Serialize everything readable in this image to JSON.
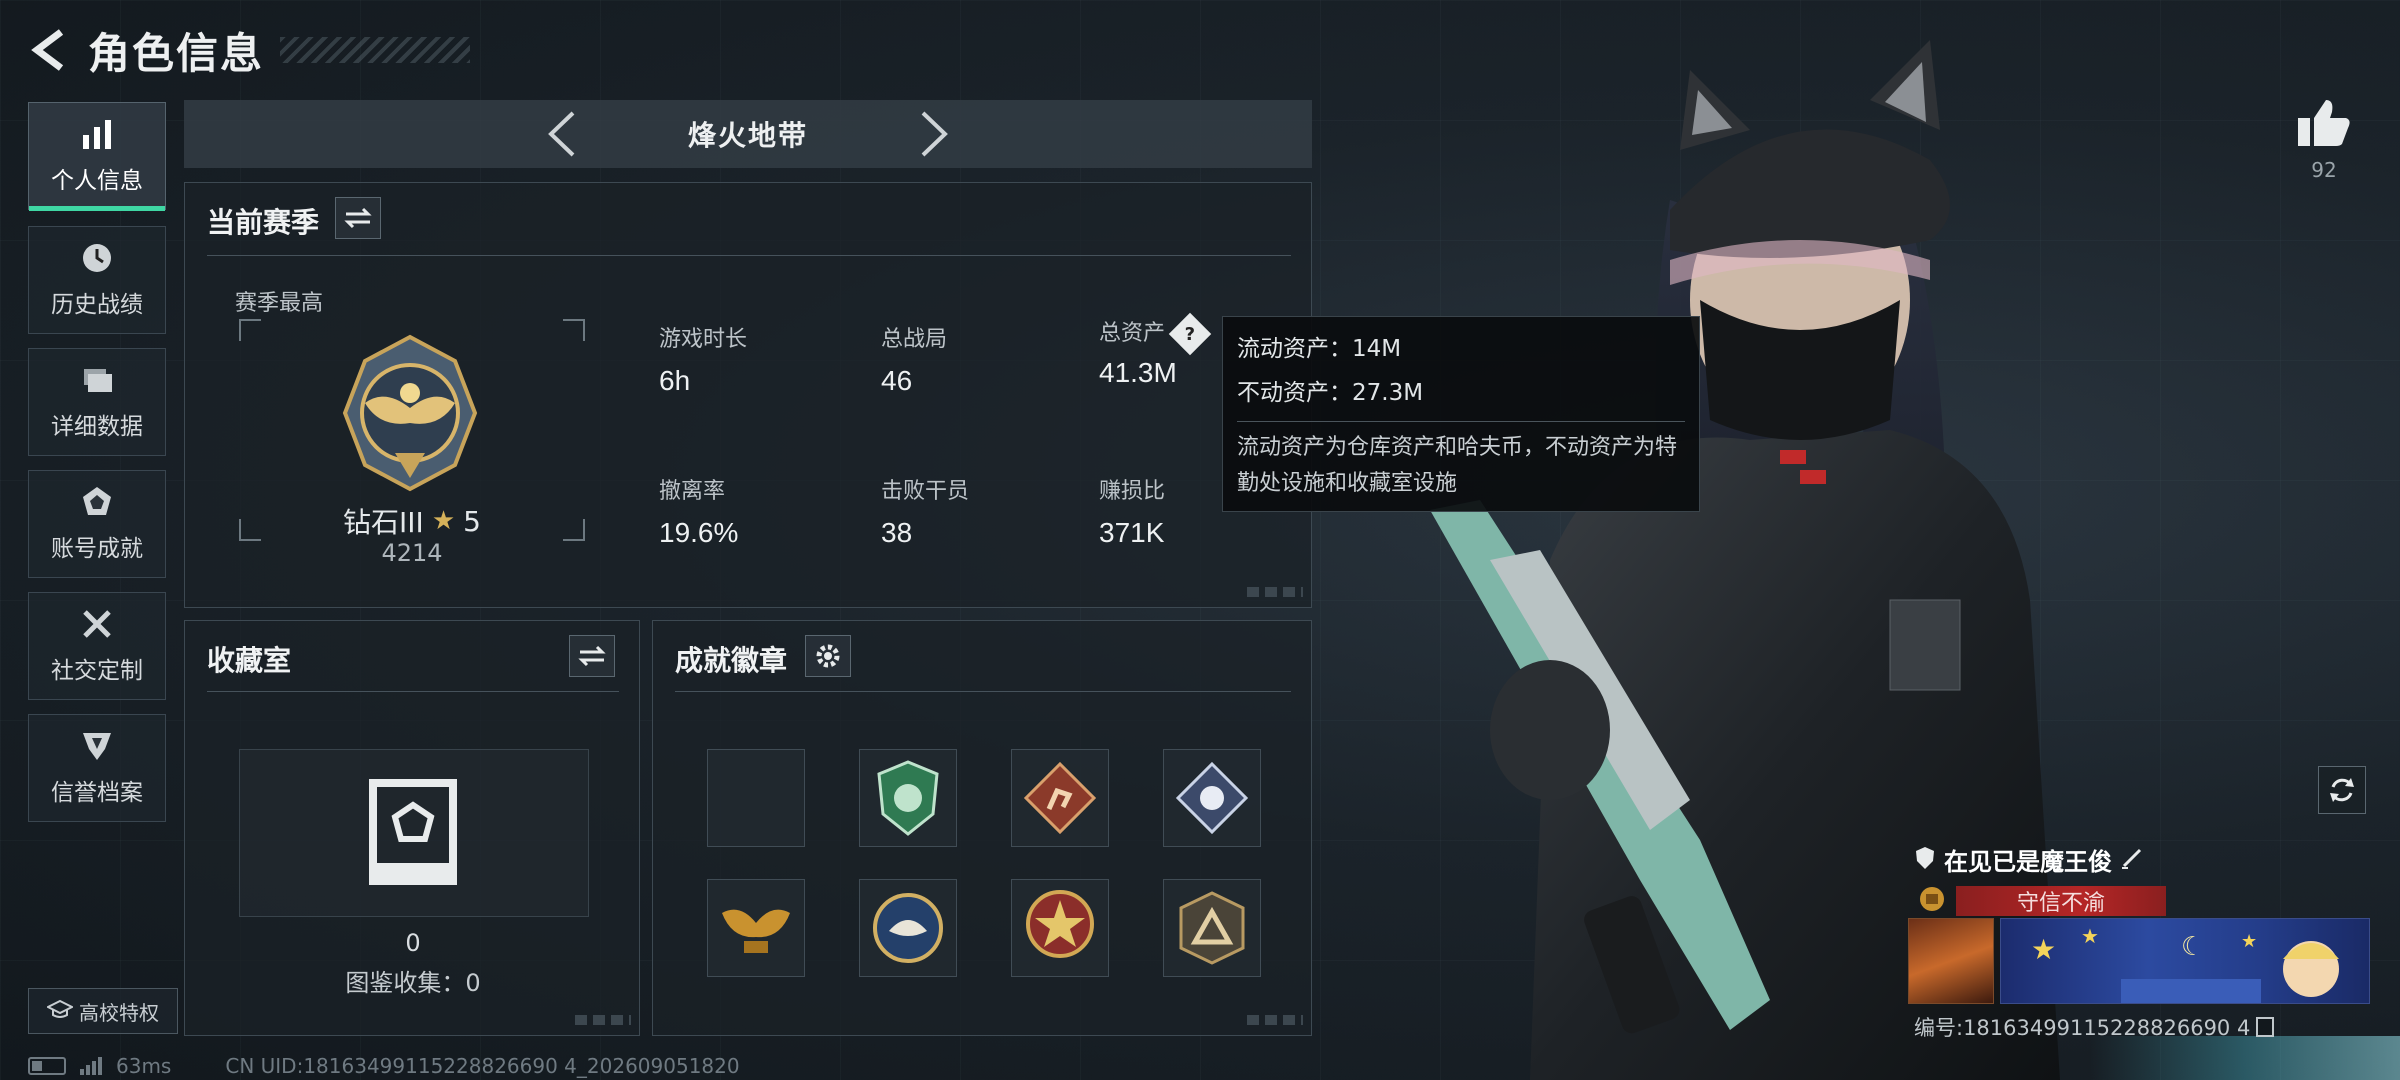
{
  "header": {
    "title": "角色信息"
  },
  "nav": [
    {
      "label": "个人信息",
      "icon": "bar-chart-icon",
      "active": true
    },
    {
      "label": "历史战绩",
      "icon": "clock-icon"
    },
    {
      "label": "详细数据",
      "icon": "folder-icon"
    },
    {
      "label": "账号成就",
      "icon": "achievement-icon"
    },
    {
      "label": "社交定制",
      "icon": "tools-icon"
    },
    {
      "label": "信誉档案",
      "icon": "credit-icon"
    }
  ],
  "campus": {
    "label": "高校特权"
  },
  "status": {
    "ping": "63ms",
    "uid": "CN UID:18163499115228826690 4_202609051820"
  },
  "mode": {
    "name": "烽火地带"
  },
  "season": {
    "title": "当前赛季",
    "best_label": "赛季最高",
    "rank_name": "钻石III",
    "rank_stars": "5",
    "rank_score": "4214",
    "stats": [
      {
        "label": "游戏时长",
        "value": "6h"
      },
      {
        "label": "总战局",
        "value": "46"
      },
      {
        "label": "总资产",
        "value": "41.3M"
      },
      {
        "label": "撤离率",
        "value": "19.6%"
      },
      {
        "label": "击败干员",
        "value": "38"
      },
      {
        "label": "赚损比",
        "value": "371K"
      }
    ]
  },
  "tooltip": {
    "liquid": "流动资产：14M",
    "fixed": "不动资产：27.3M",
    "desc": "流动资产为仓库资产和哈夫币，不动资产为特勤处设施和收藏室设施"
  },
  "collection": {
    "title": "收藏室",
    "count": "0",
    "label": "图鉴收集：0"
  },
  "badges": {
    "title": "成就徽章",
    "items": [
      "empty-slot",
      "green-shield-badge",
      "runner-badge",
      "diamond-badge",
      "eagle-wings-badge",
      "eagle-coin-badge",
      "star-badge",
      "triangle-badge"
    ]
  },
  "player": {
    "likes": "92",
    "name": "在见已是魔王俊",
    "motto": "守信不渝",
    "id": "编号:18163499115228826690 4"
  },
  "colors": {
    "accent": "#3fd7a4",
    "motto": "#b52626"
  }
}
